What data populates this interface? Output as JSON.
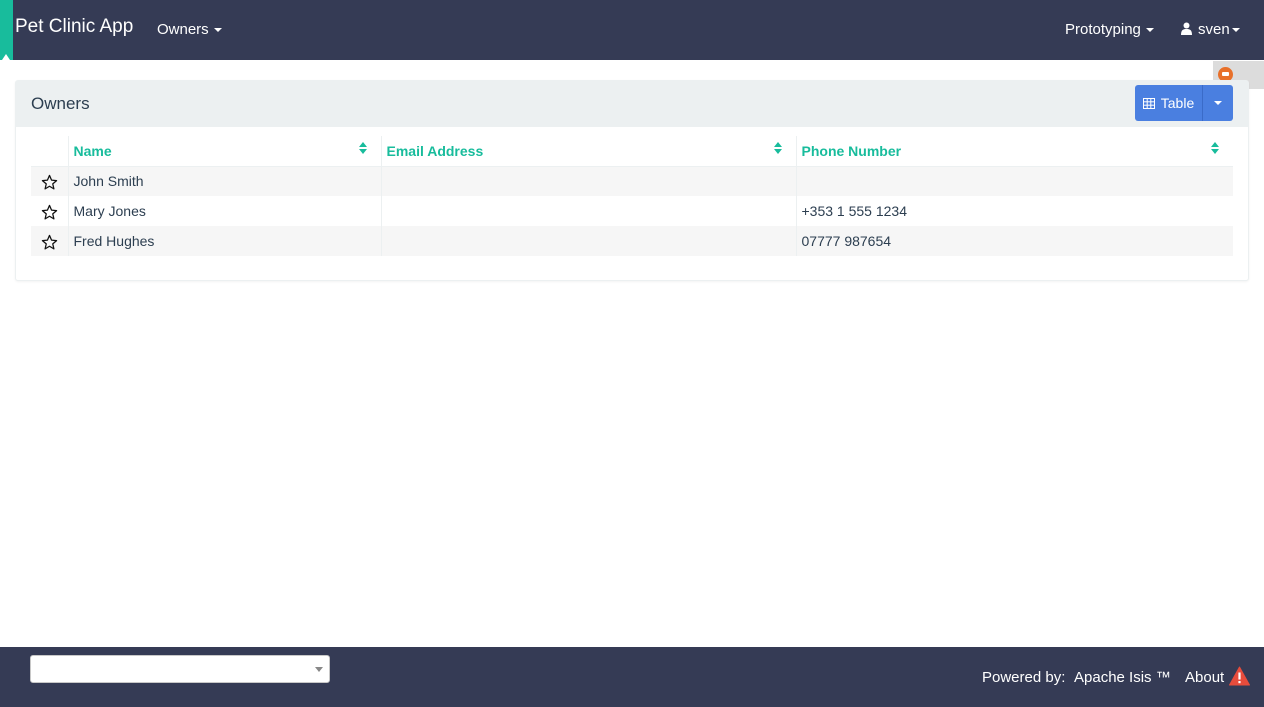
{
  "navbar": {
    "brand": "Pet Clinic App",
    "owners_menu": "Owners",
    "prototyping_menu": "Prototyping",
    "user_menu": "sven"
  },
  "panel": {
    "title": "Owners",
    "view_button_label": "Table"
  },
  "table": {
    "columns": [
      "Name",
      "Email Address",
      "Phone Number"
    ],
    "rows": [
      {
        "name": "John Smith",
        "email": "",
        "phone": ""
      },
      {
        "name": "Mary Jones",
        "email": "",
        "phone": "+353 1 555 1234"
      },
      {
        "name": "Fred Hughes",
        "email": "",
        "phone": "07777 987654"
      }
    ]
  },
  "footer": {
    "select_value": "",
    "powered_by": "Powered by:",
    "powered_link": "Apache Isis ™",
    "about": "About"
  },
  "colors": {
    "navbar_bg": "#353b55",
    "accent": "#18bc9c",
    "button_primary": "#4a7fe0",
    "warning": "#e74c3c"
  },
  "icons": {
    "user": "user-icon",
    "table_view": "table-grid-icon",
    "sort": "sort-icon",
    "bookmark": "star-outline-icon",
    "warning": "warning-triangle-icon"
  }
}
